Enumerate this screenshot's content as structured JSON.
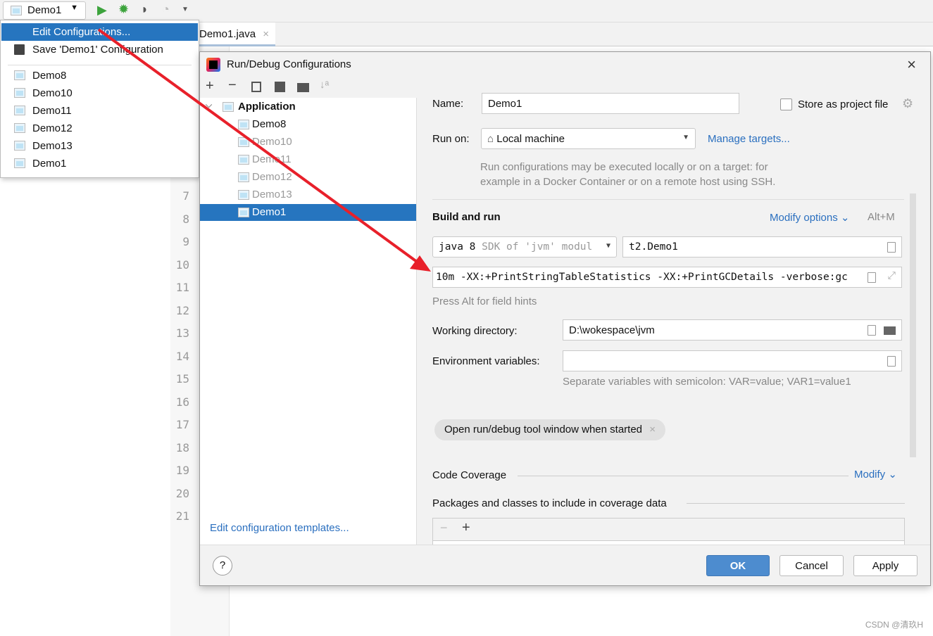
{
  "toolbar": {
    "config_selector": "Demo1"
  },
  "editor": {
    "tab": "Demo1.java",
    "line_numbers": [
      "7",
      "8",
      "9",
      "10",
      "11",
      "12",
      "13",
      "14",
      "15",
      "16",
      "17",
      "18",
      "19",
      "20",
      "21"
    ]
  },
  "popup": {
    "edit_configurations": "Edit Configurations...",
    "save_config": "Save 'Demo1' Configuration",
    "items": [
      "Demo8",
      "Demo10",
      "Demo11",
      "Demo12",
      "Demo13",
      "Demo1"
    ]
  },
  "dialog": {
    "title": "Run/Debug Configurations",
    "tree": {
      "group": "Application",
      "items": [
        "Demo8",
        "Demo10",
        "Demo11",
        "Demo12",
        "Demo13",
        "Demo1"
      ],
      "selected": "Demo1"
    },
    "edit_templates": "Edit configuration templates...",
    "name_label": "Name:",
    "name_value": "Demo1",
    "store_project_file": "Store as project file",
    "store_checked": false,
    "run_on_label": "Run on:",
    "run_on_value": "Local machine",
    "manage_targets": "Manage targets...",
    "run_on_hint_1": "Run configurations may be executed locally or on a target: for",
    "run_on_hint_2": "example in a Docker Container or on a remote host using SSH.",
    "build_and_run": "Build and run",
    "modify_options": "Modify options",
    "modify_shortcut": "Alt+M",
    "jdk_main": "java 8",
    "jdk_hint": "SDK of 'jvm' modul",
    "main_class": "t2.Demo1",
    "vm_options": "10m -XX:+PrintStringTableStatistics -XX:+PrintGCDetails -verbose:gc",
    "field_hints": "Press Alt for field hints",
    "working_dir_label": "Working directory:",
    "working_dir_value": "D:\\wokespace\\jvm",
    "env_label": "Environment variables:",
    "env_value": "",
    "env_hint": "Separate variables with semicolon: VAR=value; VAR1=value1",
    "chip": "Open run/debug tool window when started",
    "code_coverage": "Code Coverage",
    "modify": "Modify",
    "packages_label": "Packages and classes to include in coverage data",
    "ok": "OK",
    "cancel": "Cancel",
    "apply": "Apply"
  },
  "watermark": "CSDN @清玖H",
  "colors": {
    "selection": "#2675bf",
    "link": "#2a6fbf",
    "annotation_arrow": "#e8202a",
    "ok_button": "#4d8ccf"
  }
}
